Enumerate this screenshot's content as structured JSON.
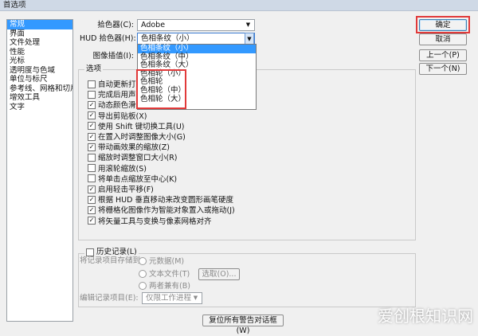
{
  "window": {
    "title": "首选项"
  },
  "sidebar": {
    "items": [
      {
        "label": "常规"
      },
      {
        "label": "界面"
      },
      {
        "label": "文件处理"
      },
      {
        "label": "性能"
      },
      {
        "label": "光标"
      },
      {
        "label": "透明度与色域"
      },
      {
        "label": "单位与标尺"
      },
      {
        "label": "参考线、网格和切片"
      },
      {
        "label": "增效工具"
      },
      {
        "label": "文字"
      }
    ]
  },
  "fields": {
    "color_picker": {
      "label": "拾色器(C):",
      "value": "Adobe"
    },
    "hud_picker": {
      "label": "HUD 拾色器(H):",
      "value": "色相条纹（小）"
    },
    "interpolation": {
      "label": "图像插值(I):"
    }
  },
  "dropdown": {
    "options": [
      "色相条纹（小）",
      "色相条纹（中）",
      "色相条纹（大）",
      "色相轮（小）",
      "色相轮",
      "色相轮（中）",
      "色相轮（大）"
    ]
  },
  "options": {
    "legend": "选项",
    "checkboxes": [
      {
        "label": "自动更新打开的",
        "checked": false
      },
      {
        "label": "完成后用声音",
        "checked": false
      },
      {
        "label": "动态颜色滑块(Y)",
        "checked": true
      },
      {
        "label": "导出剪贴板(X)",
        "checked": true
      },
      {
        "label": "使用 Shift 键切换工具(U)",
        "checked": true
      },
      {
        "label": "在置入时调整图像大小(G)",
        "checked": true
      },
      {
        "label": "带动画效果的缩放(Z)",
        "checked": true
      },
      {
        "label": "缩放时调整窗口大小(R)",
        "checked": false
      },
      {
        "label": "用滚轮缩放(S)",
        "checked": false
      },
      {
        "label": "将单击点缩放至中心(K)",
        "checked": false
      },
      {
        "label": "启用轻击平移(F)",
        "checked": true
      },
      {
        "label": "根据 HUD 垂直移动来改变圆形画笔硬度",
        "checked": true
      },
      {
        "label": "将栅格化图像作为智能对象置入或拖动(J)",
        "checked": true
      },
      {
        "label": "将矢量工具与变换与像素网格对齐",
        "checked": true
      }
    ]
  },
  "history": {
    "legend": "历史记录(L)",
    "save_to_label": "将记录项目存储到:",
    "radios": [
      {
        "label": "元数据(M)"
      },
      {
        "label": "文本文件(T)"
      },
      {
        "label": "两者兼有(B)"
      }
    ],
    "choose_label": "选取(O)...",
    "edit_log_label": "编辑记录项目(E):",
    "edit_log_value": "仅限工作进程"
  },
  "buttons": {
    "ok": "确定",
    "cancel": "取消",
    "prev": "上一个(P)",
    "next": "下一个(N)",
    "reset": "复位所有警告对话框(W)"
  },
  "watermark": "爱创根知识网"
}
